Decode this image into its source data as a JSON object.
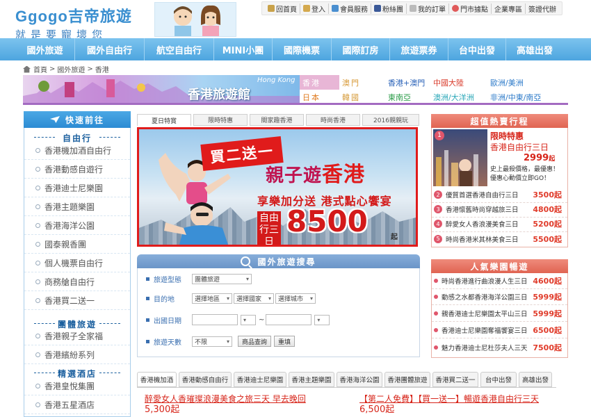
{
  "header": {
    "logo_text": "Ggogo吉帝旅遊",
    "slogan": "就是要寵壞您",
    "top_links": [
      "回首頁",
      "登入",
      "會員服務",
      "粉絲團",
      "我的訂單",
      "門市據點",
      "企業專區",
      "簽證代辦"
    ]
  },
  "main_nav": [
    "國外旅遊",
    "國外自由行",
    "航空自由行",
    "MINI小團",
    "國際機票",
    "國際訂房",
    "旅遊票券",
    "台中出發",
    "高雄出發"
  ],
  "breadcrumb": {
    "items": [
      "首頁",
      "國外旅遊",
      "香港"
    ],
    "sep": ">"
  },
  "banner": {
    "title": "香港旅遊館",
    "subtitle": "Hong Kong"
  },
  "destinations": [
    {
      "label": "香港",
      "color": "#e8b6d6",
      "text": "#fff"
    },
    {
      "label": "澳門",
      "color": "#fff",
      "text": "#d89a38"
    },
    {
      "label": "香港+澳門",
      "color": "#fff",
      "text": "#2a62b8"
    },
    {
      "label": "中國大陸",
      "color": "#fff",
      "text": "#d93a2a"
    },
    {
      "label": "歐洲/美洲",
      "color": "#fff",
      "text": "#2a78c8"
    },
    {
      "label": "日本",
      "color": "#fff",
      "text": "#e07b20"
    },
    {
      "label": "韓國",
      "color": "#fff",
      "text": "#d59a38"
    },
    {
      "label": "東南亞",
      "color": "#fff",
      "text": "#2c9c4a"
    },
    {
      "label": "澳洲/大洋洲",
      "color": "#fff",
      "text": "#2aa7b8"
    },
    {
      "label": "非洲/中東/南亞",
      "color": "#fff",
      "text": "#2a78c8"
    }
  ],
  "sidebar": {
    "heading": "快速前往",
    "sections": [
      {
        "title": "自由行",
        "items": [
          "香港機加酒自由行",
          "香港動感自遊行",
          "香港迪士尼樂園",
          "香港主題樂園",
          "香港海洋公園",
          "國泰親香團",
          "個人機票自由行",
          "商務艙自由行",
          "香港買二送一"
        ]
      },
      {
        "title": "團體旅遊",
        "items": [
          "香港親子全家福",
          "香港繽紛系列"
        ]
      },
      {
        "title": "精選酒店",
        "items": [
          "香港皇悅集團",
          "香港五星酒店"
        ]
      }
    ]
  },
  "center_tabs": [
    "夏日特賞",
    "限時特惠",
    "閤家趣香港",
    "時尚香港",
    "2016親親玩"
  ],
  "promo": {
    "badge": "買二送一",
    "title_a": "親子遊",
    "title_b": "香港",
    "tagline": "享樂加分送 港式點心饗宴",
    "box": "自由行三日",
    "price": "8500",
    "suffix": "起"
  },
  "search": {
    "title": "國外旅遊搜尋",
    "rows": [
      {
        "label": "旅遊型態",
        "selects": [
          "團體旅遊"
        ]
      },
      {
        "label": "目的地",
        "selects": [
          "選擇地區",
          "選擇國家",
          "選擇城市"
        ]
      },
      {
        "label": "出國日期",
        "date_sep": "~"
      },
      {
        "label": "旅遊天數",
        "selects": [
          "不限"
        ],
        "buttons": [
          "商品查詢",
          "重填"
        ]
      }
    ]
  },
  "hot": {
    "title": "超值熱賣行程",
    "feature": {
      "num": "1",
      "tag": "限時特惠",
      "name": "香港自由行三日",
      "price": "2999",
      "suffix": "起",
      "desc": "史上最殺價格，最優惠！優惠心動價立即GO！"
    },
    "items": [
      {
        "num": "2",
        "name": "優質首選香港自由行三日",
        "price": "3500起"
      },
      {
        "num": "3",
        "name": "香港懷舊時尚穿越旅三日",
        "price": "4800起"
      },
      {
        "num": "4",
        "name": "醉愛女人香浪漫美食三日",
        "price": "5200起"
      },
      {
        "num": "5",
        "name": "時尚香港米其林美食三日",
        "price": "5500起"
      }
    ]
  },
  "park": {
    "title": "人氣樂園暢遊",
    "items": [
      {
        "name": "時尚香港進行曲浪漫人生三日",
        "price": "4600起"
      },
      {
        "name": "動感之水都香港海洋公園三日",
        "price": "5999起"
      },
      {
        "name": "親香港迪士尼樂園太平山三日",
        "price": "5999起"
      },
      {
        "name": "香港迪士尼樂園奪福饗宴三日",
        "price": "6500起"
      },
      {
        "name": "魅力香港迪士尼杜莎夫人三天",
        "price": "7500起"
      }
    ]
  },
  "bottom_tabs": [
    "香港機加酒",
    "香港動感自由行",
    "香港迪士尼樂園",
    "香港主題樂園",
    "香港海洋公園",
    "香港團體旅遊",
    "香港買二送一",
    "台中出發",
    "高雄出發"
  ],
  "deals": [
    {
      "title": "醉愛女人香璀璨浪漫美食之旅三天 早去晚回",
      "price": "5,300起"
    },
    {
      "title": "【第二人免費】【買一送一】暢遊香港自由行三天",
      "price": "6,500起"
    }
  ],
  "colors": {
    "nav_blue": "#4da5df",
    "accent_red": "#e01b1b",
    "price_red": "#e03b2a",
    "purple": "#a36bc1"
  }
}
